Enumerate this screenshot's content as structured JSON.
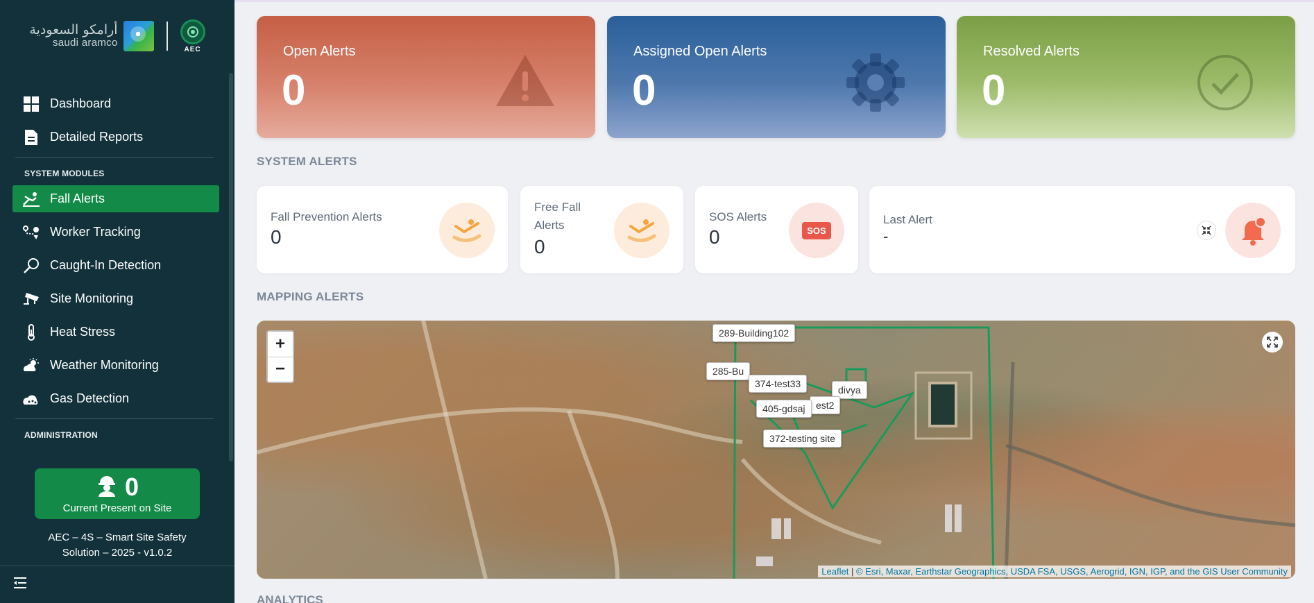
{
  "sidebar": {
    "logo": {
      "arabic": "أرامكو السعودية",
      "english": "saudi aramco",
      "aec": "AEC"
    },
    "nav_main": [
      {
        "label": "Dashboard",
        "icon": "dashboard-icon"
      },
      {
        "label": "Detailed Reports",
        "icon": "report-icon"
      }
    ],
    "modules_title": "SYSTEM MODULES",
    "modules": [
      {
        "label": "Fall Alerts",
        "icon": "fall-icon",
        "active": true
      },
      {
        "label": "Worker Tracking",
        "icon": "route-icon"
      },
      {
        "label": "Caught-In Detection",
        "icon": "magnifier-icon"
      },
      {
        "label": "Site Monitoring",
        "icon": "cctv-icon"
      },
      {
        "label": "Heat Stress",
        "icon": "thermometer-icon"
      },
      {
        "label": "Weather Monitoring",
        "icon": "weather-icon"
      },
      {
        "label": "Gas Detection",
        "icon": "gas-icon"
      }
    ],
    "admin_title": "ADMINISTRATION",
    "present": {
      "count": "0",
      "label": "Current Present on Site"
    },
    "version_line1": "AEC – 4S – Smart Site Safety",
    "version_line2": "Solution – 2025 - v1.0.2"
  },
  "cards": {
    "open": {
      "label": "Open Alerts",
      "value": "0"
    },
    "assigned": {
      "label": "Assigned Open Alerts",
      "value": "0"
    },
    "resolved": {
      "label": "Resolved Alerts",
      "value": "0"
    }
  },
  "system_alerts": {
    "title": "SYSTEM ALERTS",
    "fall_prevention": {
      "label": "Fall Prevention Alerts",
      "value": "0"
    },
    "free_fall": {
      "label_1": "Free Fall",
      "label_2": "Alerts",
      "value": "0"
    },
    "sos": {
      "label": "SOS Alerts",
      "value": "0",
      "badge": "SOS"
    },
    "last_alert": {
      "label": "Last Alert",
      "value": "-"
    }
  },
  "mapping": {
    "title": "MAPPING ALERTS",
    "zoom_in": "+",
    "zoom_out": "−",
    "labels": [
      "289-Building102",
      "285-Bu",
      "374-test33",
      "divya",
      "405-gdsaj",
      "est2",
      "372-testing site"
    ],
    "attribution": {
      "leaflet": "Leaflet",
      "separator": "|",
      "copyright": "© Esri, Maxar, Earthstar Geographics, USDA FSA, USGS, Aerogrid, IGN, IGP, and the GIS User Community"
    }
  },
  "analytics_title": "ANALYTICS",
  "colors": {
    "sidebar_bg": "#12313a",
    "active_green": "#138a48",
    "open_red": "#c55f45",
    "assigned_blue": "#2b5f99",
    "resolved_green": "#7b9f45",
    "site_boundary": "#1a9a5a"
  }
}
